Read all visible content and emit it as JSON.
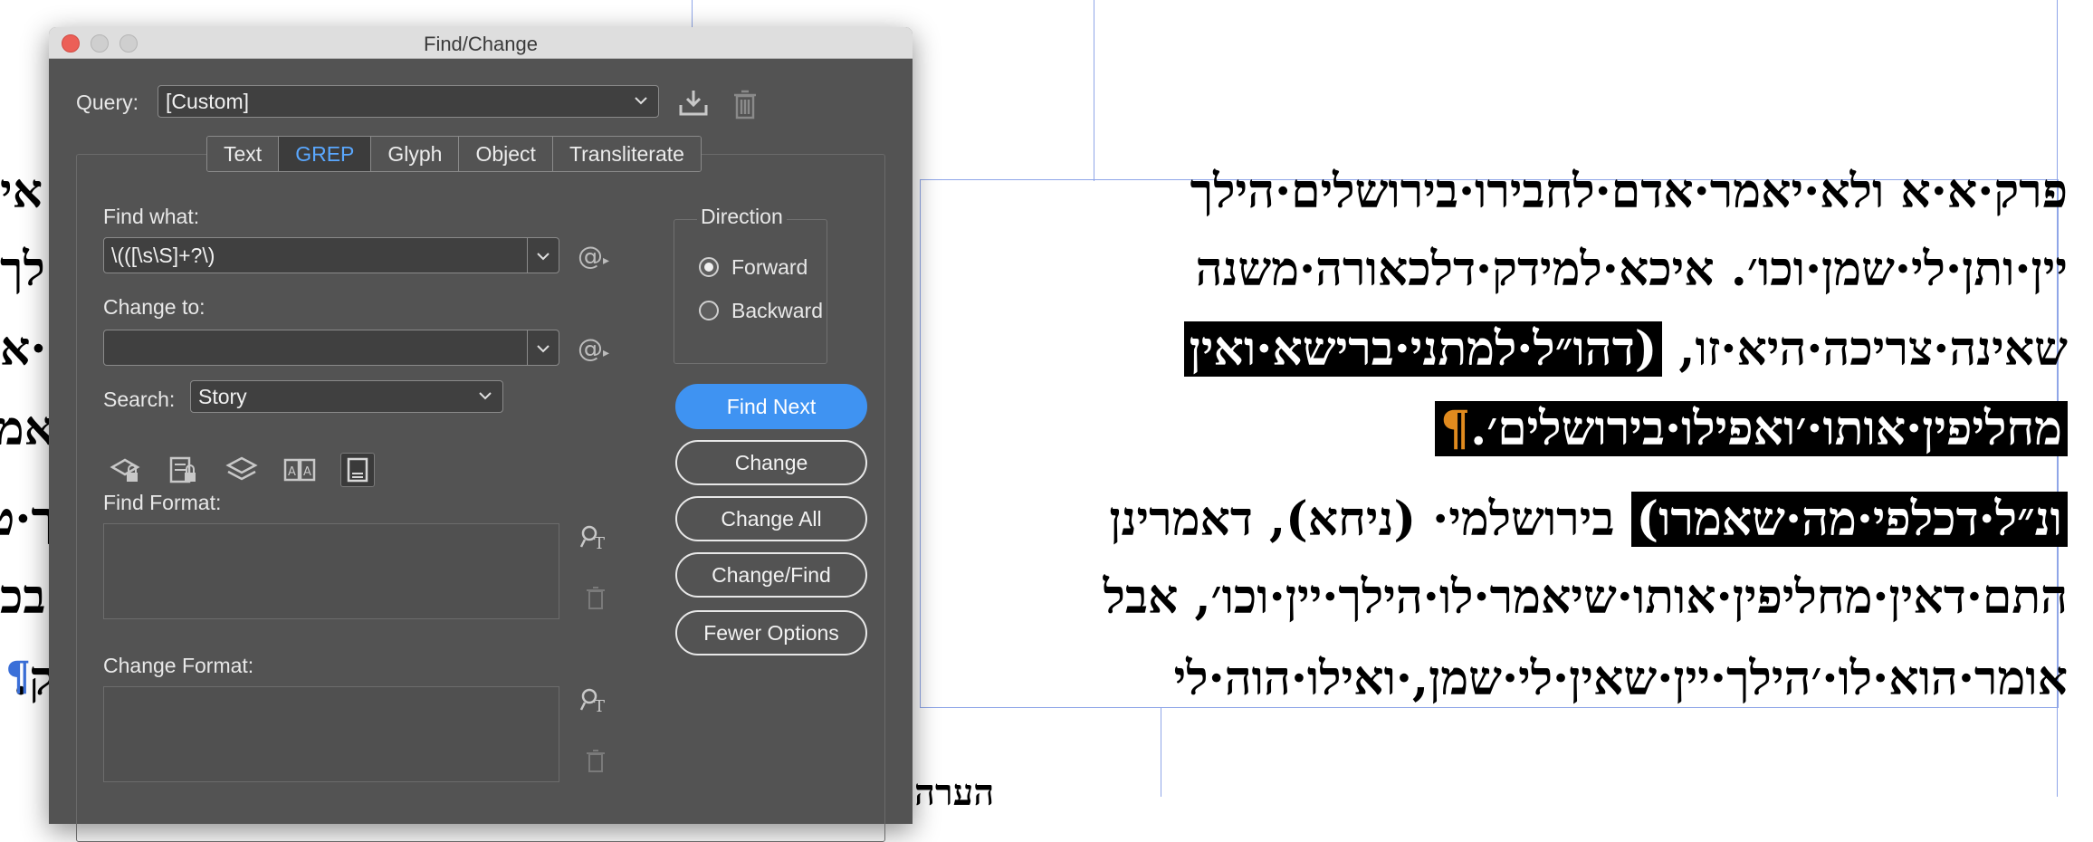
{
  "dialog": {
    "title": "Find/Change",
    "query_label": "Query:",
    "query_value": "[Custom]",
    "tabs": [
      {
        "label": "Text",
        "active": false
      },
      {
        "label": "GREP",
        "active": true
      },
      {
        "label": "Glyph",
        "active": false
      },
      {
        "label": "Object",
        "active": false
      },
      {
        "label": "Transliterate",
        "active": false
      }
    ],
    "find_what_label": "Find what:",
    "find_what_value": "\\(([\\s\\S]+?\\)",
    "change_to_label": "Change to:",
    "change_to_value": "",
    "search_label": "Search:",
    "search_value": "Story",
    "find_format_label": "Find Format:",
    "change_format_label": "Change Format:",
    "direction": {
      "label": "Direction",
      "forward": "Forward",
      "backward": "Backward",
      "selected": "forward"
    },
    "buttons": {
      "find_next": "Find Next",
      "change": "Change",
      "change_all": "Change All",
      "change_find": "Change/Find",
      "fewer_options": "Fewer Options"
    },
    "accent_color": "#3f93f2"
  },
  "document": {
    "lines": [
      "פרק·א·א ולא·יאמר·אדם·לחבירו·בירושלים·הילך",
      "יין·ותן·לי·שמן·וכו׳. איכא·למידק·דלכאורה·משנה",
      "שאינה·צריכה·היא·זו, (דהו״ל·למתני·ברישא·ואין",
      "מחליפין·אותו·׳ואפילו·בירושלים׳.¶",
      "ונ״ל·דכלפי·מה·שאמרו) בירושלמי· (ניחא), דאמרינן",
      "התם·דאין·מחליפין·אותו·שיאמר·לו·הילך·יין·וכו׳, אבל",
      "אומר·הוא·לו·׳הילך·יין·שאין·לי·שמן,·ואילו·הוה·לי"
    ],
    "line3_plain": "שאינה·צריכה·היא·זו, ",
    "line3_hl": "(דהו״ל·למתני·ברישא·ואין",
    "line4_hl": "מחליפין·אותו·׳ואפילו·בירושלים׳.",
    "line4_pil": "¶",
    "line5_hl": "ונ״ל·דכלפי·מה·שאמרו)",
    "line5_rest": " בירושלמי· (ניחא), דאמרינן",
    "left_fragments": [
      "אי",
      "לך",
      "·א",
      "אמ",
      "ך·ט",
      "בכ",
      "ק."
    ],
    "left_pilcrow": "¶",
    "bottom_fragment": "הערה"
  }
}
